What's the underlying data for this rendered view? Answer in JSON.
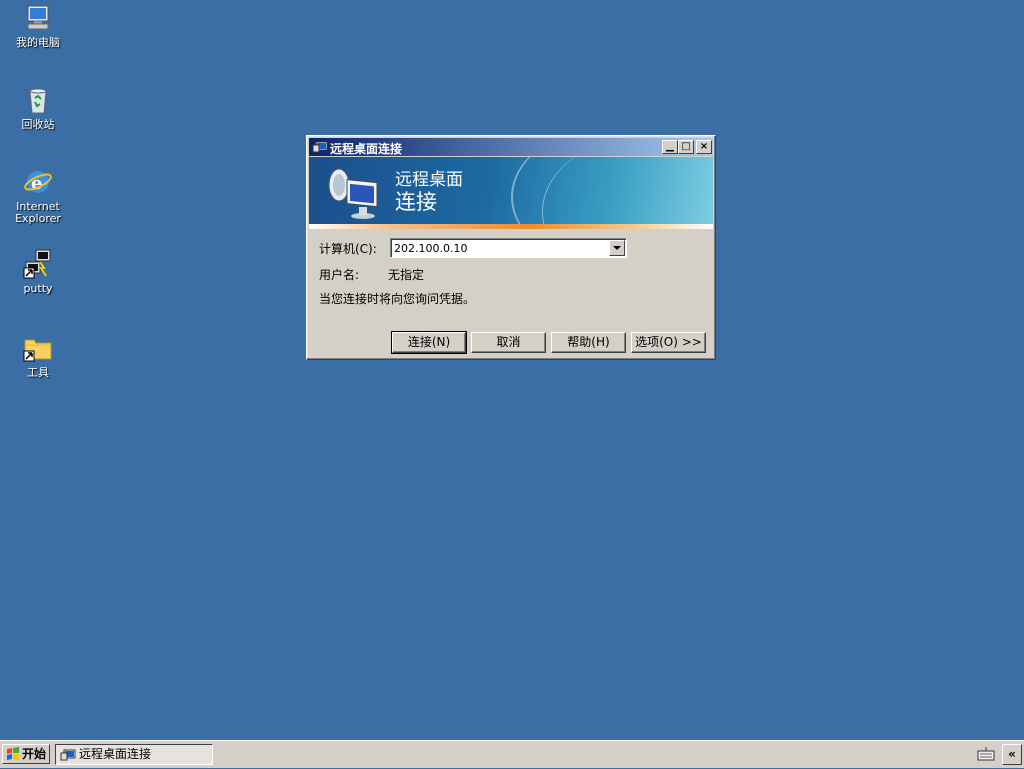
{
  "desktop": {
    "icons": [
      {
        "label": "我的电脑"
      },
      {
        "label": "回收站"
      },
      {
        "label": "Internet Explorer"
      },
      {
        "label": "putty"
      },
      {
        "label": "工具"
      }
    ]
  },
  "window": {
    "title": "远程桌面连接",
    "banner_line1": "远程桌面",
    "banner_line2": "连接",
    "computer_label": "计算机(C):",
    "computer_value": "202.100.0.10",
    "username_label": "用户名:",
    "username_value": "无指定",
    "info_text": "当您连接时将向您询问凭据。",
    "buttons": {
      "connect": "连接(N)",
      "cancel": "取消",
      "help": "帮助(H)",
      "options": "选项(O) >>"
    }
  },
  "taskbar": {
    "start_label": "开始",
    "task_item": "远程桌面连接",
    "tray_toggle": "«"
  },
  "colors": {
    "desktop": "#3a6ea5",
    "titlebar_start": "#0a246a",
    "titlebar_end": "#a6caf0"
  }
}
